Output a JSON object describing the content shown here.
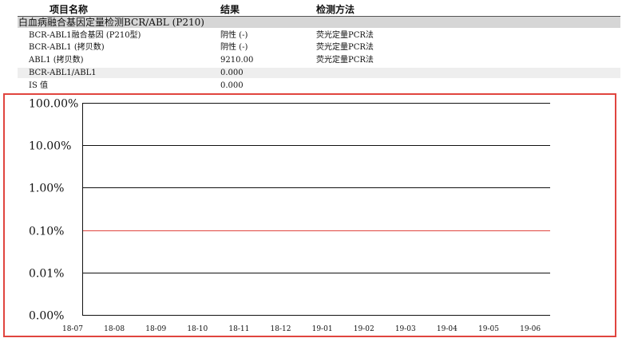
{
  "table": {
    "headers": [
      "项目名称",
      "结果",
      "检测方法"
    ],
    "group_title": "白血病融合基因定量检测BCR/ABL (P210)",
    "rows": [
      {
        "name": "BCR-ABL1融合基因 (P210型)",
        "result": "阴性 (-)",
        "method": "荧光定量PCR法"
      },
      {
        "name": "BCR-ABL1 (拷贝数)",
        "result": "阴性 (-)",
        "method": "荧光定量PCR法"
      },
      {
        "name": "ABL1 (拷贝数)",
        "result": "9210.00",
        "method": "荧光定量PCR法"
      },
      {
        "name": "BCR-ABL1/ABL1",
        "result": "0.000",
        "method": ""
      },
      {
        "name": "IS 值",
        "result": "0.000",
        "method": ""
      }
    ]
  },
  "chart_data": {
    "type": "line",
    "y_scale": "log",
    "y_tick_labels": [
      "100.00%",
      "10.00%",
      "1.00%",
      "0.10%",
      "0.01%",
      "0.00%"
    ],
    "x_tick_labels": [
      "18-07",
      "18-08",
      "18-09",
      "18-10",
      "18-11",
      "18-12",
      "19-01",
      "19-02",
      "19-03",
      "19-04",
      "19-05",
      "19-06"
    ],
    "threshold_line": {
      "at_label": "0.10%",
      "color": "#e0453f"
    },
    "series": [],
    "grid": true,
    "legend": "none"
  },
  "colors": {
    "highlight_border": "#e0453f",
    "threshold": "#e0453f"
  }
}
